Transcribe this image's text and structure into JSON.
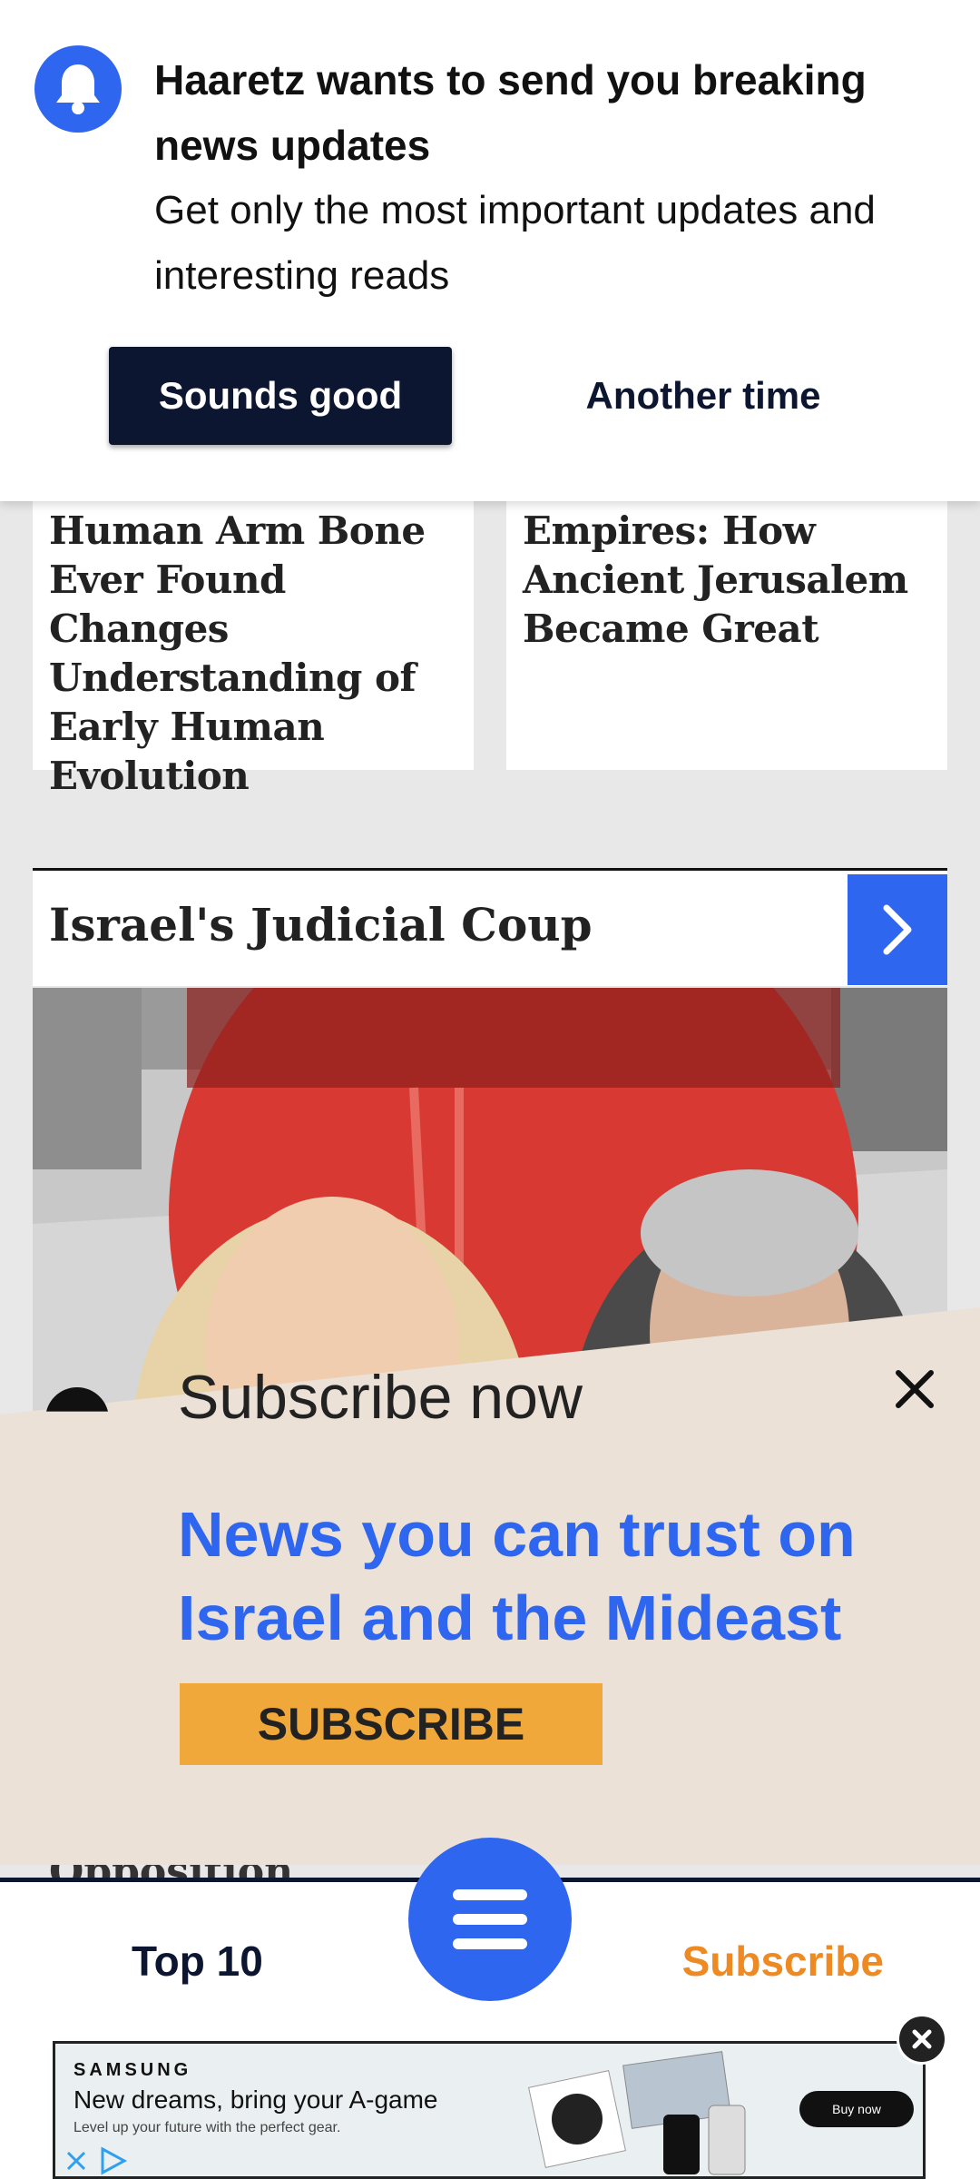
{
  "notification": {
    "title": "Haaretz wants to send you breaking news updates",
    "description": "Get only the most important updates and interesting reads",
    "accept_label": "Sounds good",
    "decline_label": "Another time"
  },
  "cards": [
    {
      "headline": "Human Arm Bone Ever Found Changes Understanding of Early Human Evolution"
    },
    {
      "headline": "Empires: How Ancient Jerusalem Became Great"
    }
  ],
  "section": {
    "title": "Israel's Judicial Coup"
  },
  "subscribe_banner": {
    "lead": "Subscribe now",
    "tagline": "News you can trust on Israel and the Mideast",
    "button_label": "SUBSCRIBE"
  },
  "peek_text": "Opposition",
  "bottom_nav": {
    "top10_label": "Top 10",
    "subscribe_label": "Subscribe"
  },
  "ad": {
    "brand": "SAMSUNG",
    "headline": "New dreams, bring your A-game",
    "subline": "Level up your future with the perfect gear.",
    "button_label": "Buy now"
  },
  "colors": {
    "accent_blue": "#2f66f0",
    "navy": "#0d1630",
    "subscribe_orange": "#ee8a23",
    "banner_bg": "#ece1d7",
    "subscribe_button": "#f0a83a"
  }
}
